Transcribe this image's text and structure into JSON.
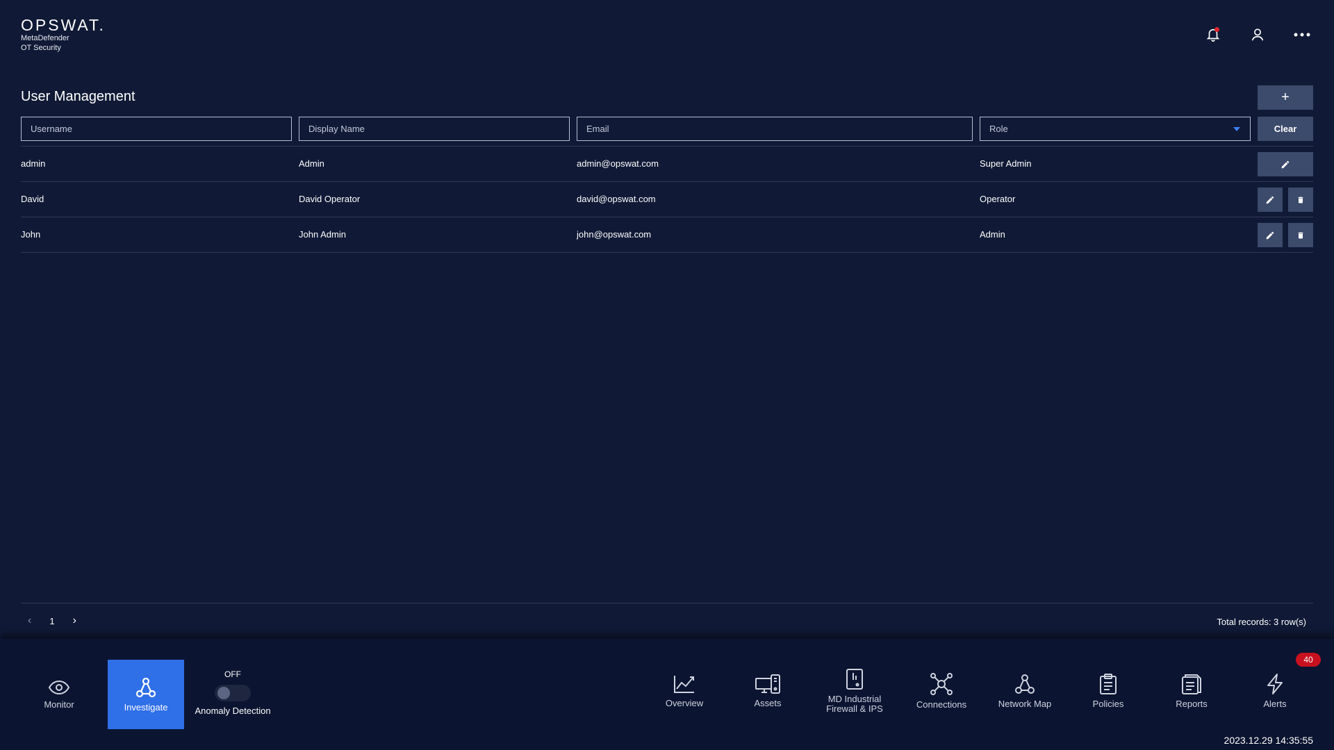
{
  "brand": {
    "logo": "OPSWAT.",
    "product_line1": "MetaDefender",
    "product_line2": "OT Security"
  },
  "header": {
    "icons": [
      "bell-icon",
      "user-icon",
      "more-icon"
    ],
    "notification_color": "#e0242b"
  },
  "page": {
    "title": "User Management",
    "add_label": "+"
  },
  "filters": {
    "username_placeholder": "Username",
    "display_placeholder": "Display Name",
    "email_placeholder": "Email",
    "role_placeholder": "Role",
    "clear_label": "Clear"
  },
  "users": [
    {
      "username": "admin",
      "display_name": "Admin",
      "email": "admin@opswat.com",
      "role": "Super Admin"
    },
    {
      "username": "David",
      "display_name": "David Operator",
      "email": "david@opswat.com",
      "role": "Operator"
    },
    {
      "username": "John",
      "display_name": "John Admin",
      "email": "john@opswat.com",
      "role": "Admin"
    }
  ],
  "pagination": {
    "current_page": "1",
    "total_text": "Total records: 3 row(s)"
  },
  "bottom_nav": {
    "monitor": "Monitor",
    "investigate": "Investigate",
    "anomaly_state": "OFF",
    "anomaly_label": "Anomaly Detection",
    "overview": "Overview",
    "assets": "Assets",
    "firewall_line1": "MD Industrial",
    "firewall_line2": "Firewall & IPS",
    "connections": "Connections",
    "network_map": "Network Map",
    "policies": "Policies",
    "reports": "Reports",
    "alerts": "Alerts",
    "alerts_badge": "40",
    "accent_color": "#2f6fe8"
  },
  "clock": "2023.12.29 14:35:55"
}
